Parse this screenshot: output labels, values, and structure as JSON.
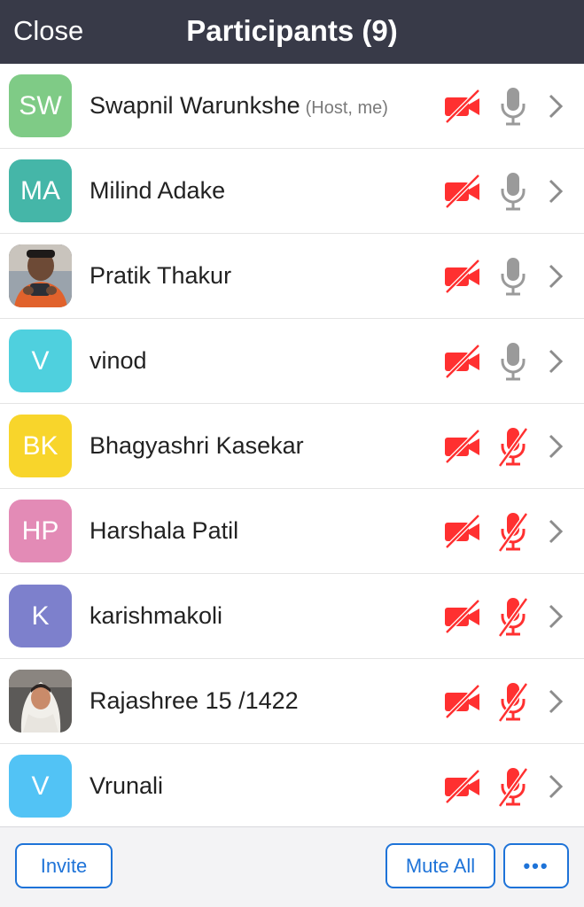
{
  "header": {
    "close_label": "Close",
    "title": "Participants (9)"
  },
  "participants": [
    {
      "initials": "SW",
      "name": "Swapnil Warunkshe",
      "role": "(Host, me)",
      "avatar_color": "#7fcb86",
      "avatar_type": "initials",
      "video": "off",
      "mic": "on"
    },
    {
      "initials": "MA",
      "name": "Milind Adake",
      "role": "",
      "avatar_color": "#45b6a8",
      "avatar_type": "initials",
      "video": "off",
      "mic": "on"
    },
    {
      "initials": "",
      "name": "Pratik Thakur",
      "role": "",
      "avatar_color": "#6b5346",
      "avatar_type": "photo",
      "video": "off",
      "mic": "on"
    },
    {
      "initials": "V",
      "name": "vinod",
      "role": "",
      "avatar_color": "#4fd0de",
      "avatar_type": "initials",
      "video": "off",
      "mic": "on"
    },
    {
      "initials": "BK",
      "name": "Bhagyashri Kasekar",
      "role": "",
      "avatar_color": "#f8d52b",
      "avatar_type": "initials",
      "video": "off",
      "mic": "muted"
    },
    {
      "initials": "HP",
      "name": "Harshala Patil",
      "role": "",
      "avatar_color": "#e38bb6",
      "avatar_type": "initials",
      "video": "off",
      "mic": "muted"
    },
    {
      "initials": "K",
      "name": "karishmakoli",
      "role": "",
      "avatar_color": "#7d80cc",
      "avatar_type": "initials",
      "video": "off",
      "mic": "muted"
    },
    {
      "initials": "",
      "name": "Rajashree 15 /1422",
      "role": "",
      "avatar_color": "#c7c2b8",
      "avatar_type": "photo",
      "video": "off",
      "mic": "muted"
    },
    {
      "initials": "V",
      "name": "Vrunali",
      "role": "",
      "avatar_color": "#52c3f5",
      "avatar_type": "initials",
      "video": "off",
      "mic": "muted"
    }
  ],
  "footer": {
    "invite_label": "Invite",
    "mute_all_label": "Mute All",
    "more_label": "•••"
  },
  "colors": {
    "header_bg": "#383a48",
    "video_off": "#ff3030",
    "mic_on": "#9a9a9a",
    "mic_muted": "#ff3030",
    "accent": "#1e73d8"
  },
  "icons": {
    "video": "video-off-icon",
    "mic_on": "microphone-icon",
    "mic_muted": "microphone-muted-icon",
    "chevron": "chevron-right-icon",
    "more": "more-horizontal-icon"
  }
}
